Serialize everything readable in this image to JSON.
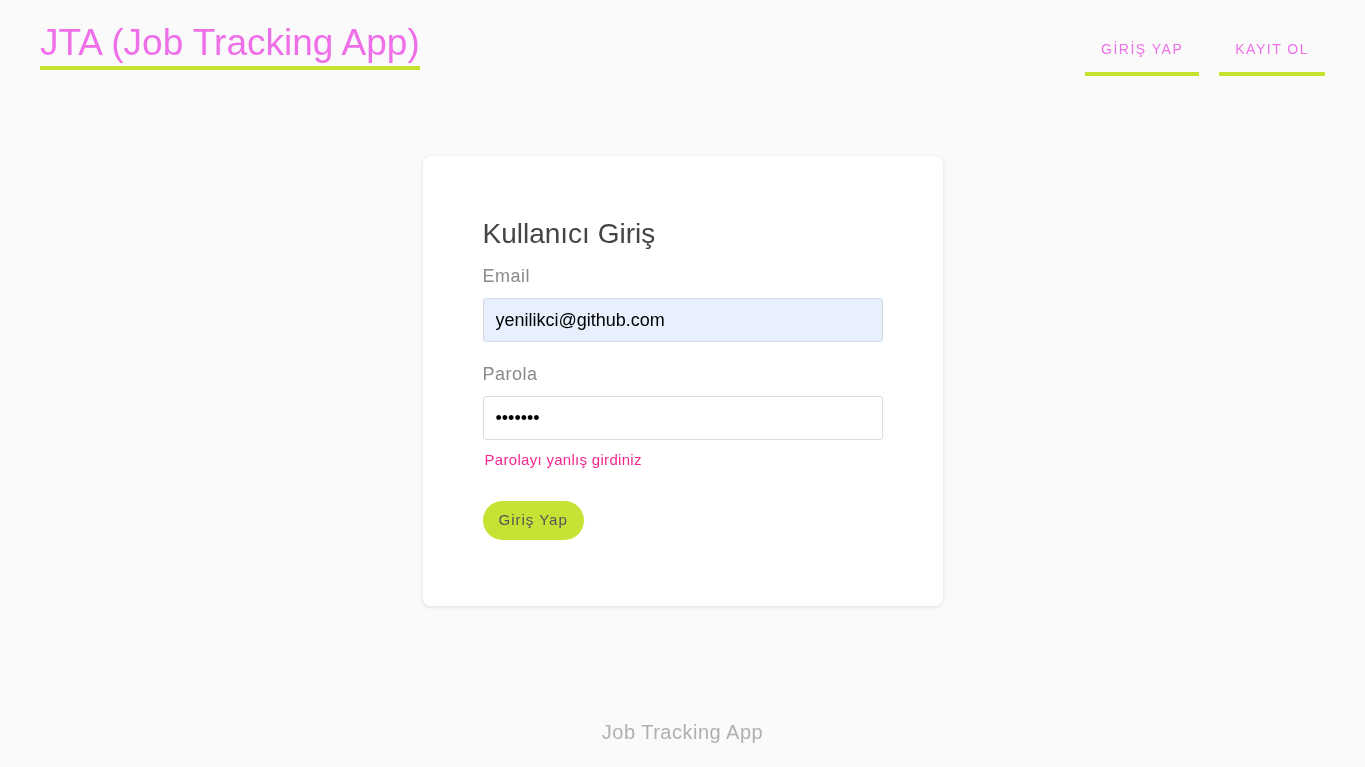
{
  "header": {
    "title": "JTA (Job Tracking App)",
    "nav": [
      {
        "label": "GİRİŞ YAP"
      },
      {
        "label": "KAYIT OL"
      }
    ]
  },
  "login_form": {
    "title": "Kullanıcı Giriş",
    "fields": [
      {
        "label": "Email",
        "value": "yenilikci@github.com",
        "autofilled": true
      },
      {
        "label": "Parola",
        "value": "•••••••",
        "autofilled": false,
        "error": "Parolayı yanlış girdiniz"
      }
    ],
    "submit": "Giriş Yap"
  },
  "footer": {
    "text": "Job Tracking App"
  }
}
